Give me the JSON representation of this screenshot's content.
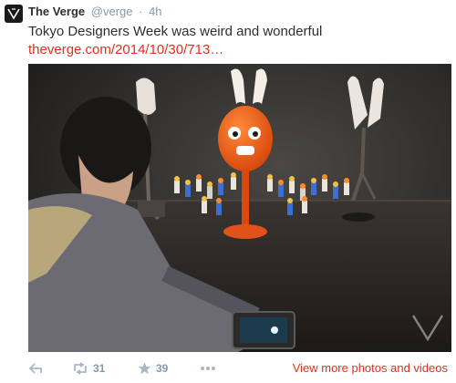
{
  "tweet": {
    "author_name": "The Verge",
    "author_handle": "@verge",
    "separator": "·",
    "timestamp": "4h",
    "text": "Tokyo Designers Week was weird and wonderful",
    "link_text": "theverge.com/2014/10/30/713…",
    "media": {
      "watermark_icon": "verge-logo-icon"
    }
  },
  "actions": {
    "reply_icon": "reply-icon",
    "retweet_icon": "retweet-icon",
    "retweet_count": "31",
    "favorite_icon": "star-icon",
    "favorite_count": "39",
    "more_icon": "more-dots-icon",
    "view_more_label": "View more photos and videos"
  },
  "colors": {
    "link": "#e0301e",
    "meta": "#8899a6",
    "text": "#292f33",
    "avatar_bg": "#1a1a1a"
  }
}
